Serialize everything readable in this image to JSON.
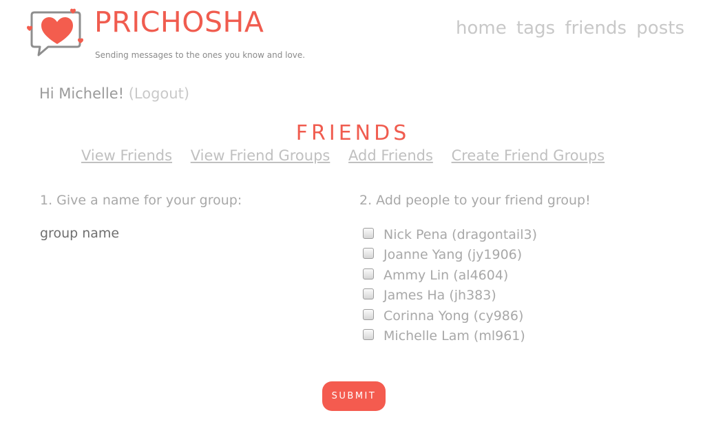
{
  "header": {
    "brand": "PRICHOSHA",
    "tagline": "Sending messages to the ones you know and love.",
    "logo_icon": "heart-speech-bubble-icon",
    "brand_color": "#f05c4f"
  },
  "topnav": {
    "items": [
      {
        "label": "home"
      },
      {
        "label": "tags"
      },
      {
        "label": "friends"
      },
      {
        "label": "posts"
      }
    ]
  },
  "greeting": {
    "text": "Hi Michelle!",
    "logout_label": "(Logout)"
  },
  "friends_section": {
    "title": "FRIENDS",
    "subnav": [
      {
        "label": "View Friends"
      },
      {
        "label": "View Friend Groups"
      },
      {
        "label": "Add Friends"
      },
      {
        "label": "Create Friend Groups"
      }
    ]
  },
  "form": {
    "step1_label": "1. Give a name for your group:",
    "group_name_placeholder": "group name",
    "group_name_value": "",
    "step2_label": "2. Add people to your friend group!",
    "friends": [
      {
        "label": "Nick Pena (dragontail3)",
        "checked": false
      },
      {
        "label": "Joanne Yang (jy1906)",
        "checked": false
      },
      {
        "label": "Ammy Lin (al4604)",
        "checked": false
      },
      {
        "label": "James Ha (jh383)",
        "checked": false
      },
      {
        "label": "Corinna Yong (cy986)",
        "checked": false
      },
      {
        "label": "Michelle Lam (ml961)",
        "checked": false
      }
    ],
    "submit_label": "SUBMIT",
    "submit_color": "#f45b4f"
  }
}
